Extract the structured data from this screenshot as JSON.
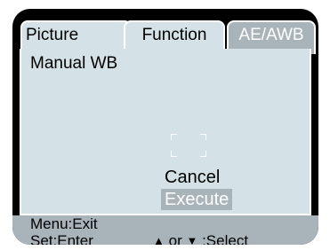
{
  "tabs": [
    {
      "label": "Picture",
      "active": false
    },
    {
      "label": "Function",
      "active": false
    },
    {
      "label": "AE/AWB",
      "active": true
    }
  ],
  "panel": {
    "title": "Manual WB",
    "options": [
      {
        "label": "Cancel",
        "selected": false
      },
      {
        "label": "Execute",
        "selected": true
      }
    ]
  },
  "footer": {
    "menu_hint": "Menu:Exit",
    "set_hint": "Set:Enter",
    "up_arrow": "▲",
    "or_text": "or",
    "down_arrow": "▼",
    "select_text": ":Select"
  },
  "colors": {
    "panel_bg": "#d4e1e7",
    "highlight": "#a9b3ba",
    "frame": "#000000"
  }
}
